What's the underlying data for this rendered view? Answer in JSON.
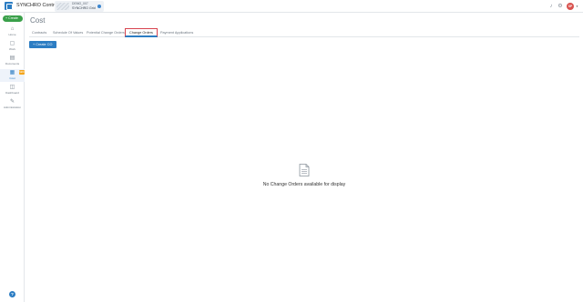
{
  "app": {
    "title": "SYNCHRO Control"
  },
  "project": {
    "code": "DEMO_007",
    "name": "SYNCHRO Grid"
  },
  "user": {
    "initials": "SP"
  },
  "sidebar": {
    "create_label": "+ Create",
    "items": [
      {
        "label": "Home",
        "icon": "home-icon"
      },
      {
        "label": "Work",
        "icon": "work-icon"
      },
      {
        "label": "Documents",
        "icon": "documents-icon"
      },
      {
        "label": "Cost",
        "icon": "cost-icon",
        "active": true,
        "badge": "NEW"
      },
      {
        "label": "Dashboard",
        "icon": "dashboard-icon"
      },
      {
        "label": "Administration",
        "icon": "administration-icon"
      }
    ],
    "help_label": "?"
  },
  "main": {
    "title": "Cost",
    "tabs": [
      {
        "label": "Contracts"
      },
      {
        "label": "Schedule Of Values"
      },
      {
        "label": "Potential Change Orders"
      },
      {
        "label": "Change Orders",
        "active": true
      },
      {
        "label": "Payment Applications"
      }
    ],
    "create_button": "+ Create CO",
    "empty_message": "No Change Orders available for display"
  },
  "colors": {
    "accent": "#2c7dc3",
    "create_green": "#3aa04a",
    "active_tab_outline": "#d8434e",
    "badge": "#f4a51c"
  }
}
